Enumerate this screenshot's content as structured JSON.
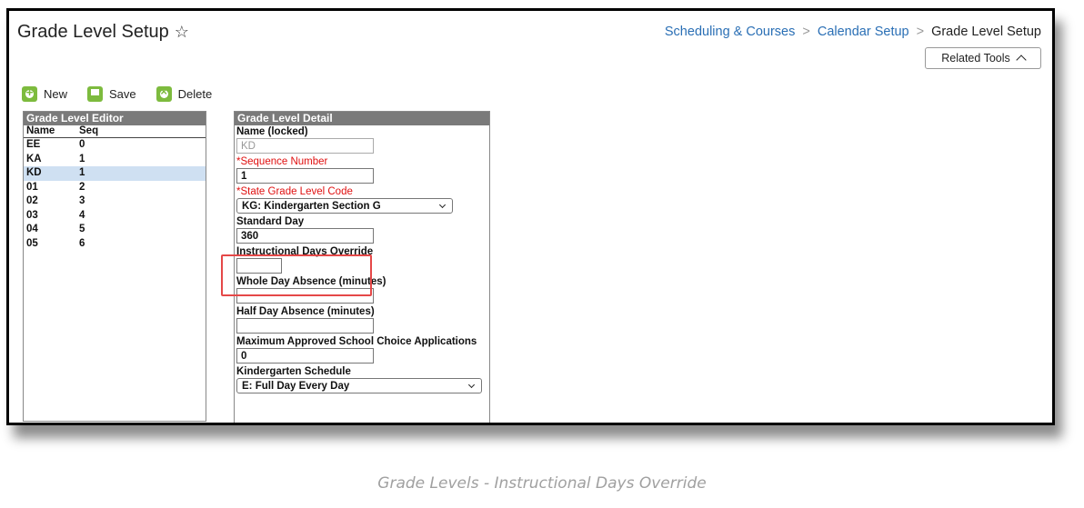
{
  "header": {
    "title": "Grade Level Setup",
    "breadcrumbs": [
      "Scheduling & Courses",
      "Calendar Setup",
      "Grade Level Setup"
    ],
    "related_tools_label": "Related Tools"
  },
  "toolbar": {
    "new_label": "New",
    "save_label": "Save",
    "delete_label": "Delete"
  },
  "editor": {
    "title": "Grade Level Editor",
    "columns": [
      "Name",
      "Seq"
    ],
    "rows": [
      {
        "name": "EE",
        "seq": "0"
      },
      {
        "name": "KA",
        "seq": "1"
      },
      {
        "name": "KD",
        "seq": "1"
      },
      {
        "name": "01",
        "seq": "2"
      },
      {
        "name": "02",
        "seq": "3"
      },
      {
        "name": "03",
        "seq": "4"
      },
      {
        "name": "04",
        "seq": "5"
      },
      {
        "name": "05",
        "seq": "6"
      }
    ],
    "selected_row": "KD"
  },
  "detail": {
    "title": "Grade Level Detail",
    "name_label": "Name (locked)",
    "name_value": "KD",
    "sequence_label": "*Sequence Number",
    "sequence_value": "1",
    "state_code_label": "*State Grade Level Code",
    "state_code_value": "KG: Kindergarten Section G",
    "standard_day_label": "Standard Day",
    "standard_day_value": "360",
    "instructional_override_label": "Instructional Days Override",
    "instructional_override_value": "",
    "whole_day_label": "Whole Day Absence (minutes)",
    "whole_day_value": "",
    "half_day_label": "Half Day Absence (minutes)",
    "half_day_value": "",
    "max_school_choice_label": "Maximum Approved School Choice Applications",
    "max_school_choice_value": "0",
    "kindergarten_schedule_label": "Kindergarten Schedule",
    "kindergarten_schedule_value": "E: Full Day Every Day"
  },
  "caption": "Grade Levels - Instructional Days Override",
  "colors": {
    "accent_green": "#7dbb3e",
    "link_blue": "#2a6fb5",
    "required_red": "#e01010",
    "highlight_red": "#e54848"
  }
}
